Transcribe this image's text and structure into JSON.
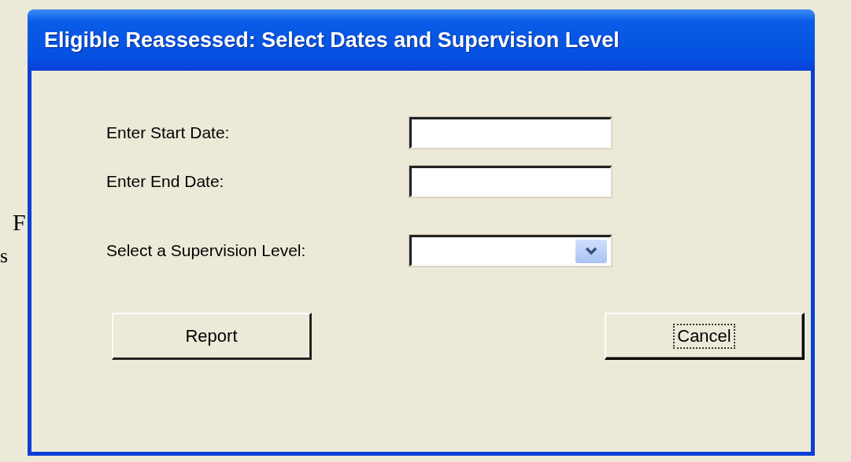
{
  "background_text": [
    "F",
    "s"
  ],
  "window": {
    "title": "Eligible Reassessed: Select Dates and Supervision Level"
  },
  "fields": [
    {
      "kind": "text",
      "label": "Enter Start Date:"
    },
    {
      "kind": "text",
      "label": "Enter End Date:"
    },
    {
      "kind": "dropdown",
      "label": "Select a Supervision Level:"
    }
  ],
  "buttons": [
    {
      "label": "Report",
      "focused": false
    },
    {
      "label": "Cancel",
      "focused": true
    }
  ]
}
